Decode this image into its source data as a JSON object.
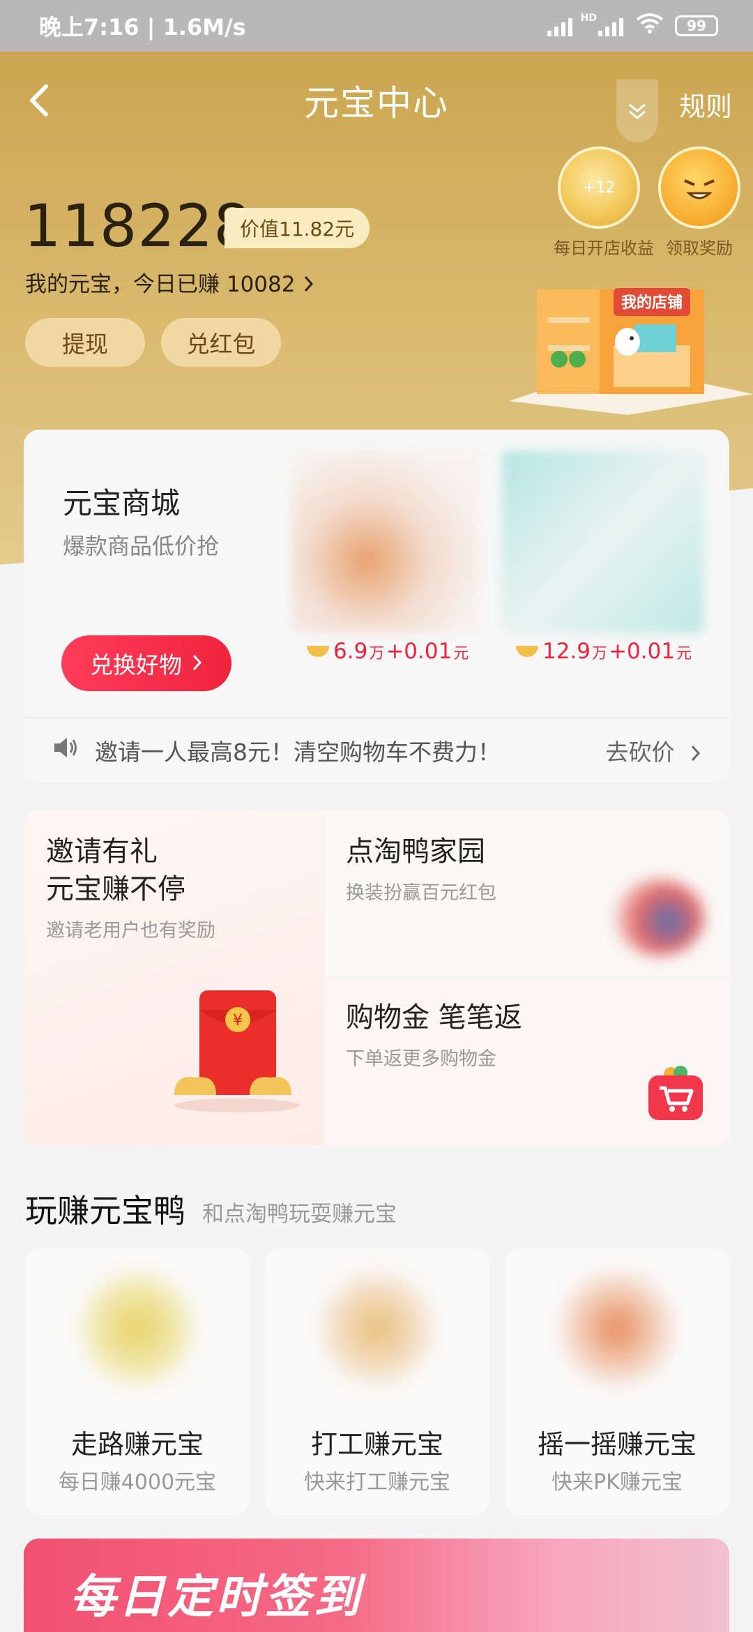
{
  "status_bar": {
    "time": "晚上7:16 | 1.6M/s",
    "battery": "99",
    "network": "HD"
  },
  "nav": {
    "title": "元宝中心",
    "rules_label": "规则"
  },
  "balance": {
    "amount": "118228",
    "value_label": "价值11.82元",
    "earned_text": "我的元宝，今日已赚 10082"
  },
  "actions": {
    "withdraw": "提现",
    "redeem": "兑红包"
  },
  "rewards": [
    {
      "badge": "+12",
      "label": "每日开店收益"
    },
    {
      "label": "领取奖励"
    }
  ],
  "shop_sign": "我的店铺",
  "mall": {
    "title": "元宝商城",
    "subtitle": "爆款商品低价抢",
    "exchange_button": "兑换好物",
    "products": [
      {
        "price_main": "6.9",
        "price_unit": "万",
        "price_extra": "+0.01",
        "price_extra_unit": "元"
      },
      {
        "price_main": "12.9",
        "price_unit": "万",
        "price_extra": "+0.01",
        "price_extra_unit": "元"
      }
    ],
    "notice": "邀请一人最高8元！清空购物车不费力！",
    "notice_action": "去砍价"
  },
  "promos": {
    "invite": {
      "line1": "邀请有礼",
      "line2": "元宝赚不停",
      "sub": "邀请老用户也有奖励"
    },
    "garden": {
      "title": "点淘鸭家园",
      "sub": "换装扮赢百元红包"
    },
    "cashback": {
      "title": "购物金 笔笔返",
      "sub": "下单返更多购物金"
    }
  },
  "games": {
    "title": "玩赚元宝鸭",
    "subtitle": "和点淘鸭玩耍赚元宝",
    "items": [
      {
        "title": "走路赚元宝",
        "sub": "每日赚4000元宝"
      },
      {
        "title": "打工赚元宝",
        "sub": "快来打工赚元宝"
      },
      {
        "title": "摇一摇赚元宝",
        "sub": "快来PK赚元宝"
      }
    ]
  },
  "banner": {
    "title": "每日定时签到"
  },
  "colors": {
    "gold": "#c9a24a",
    "red_button": "#f0233d",
    "pill": "#f1d7a1"
  }
}
